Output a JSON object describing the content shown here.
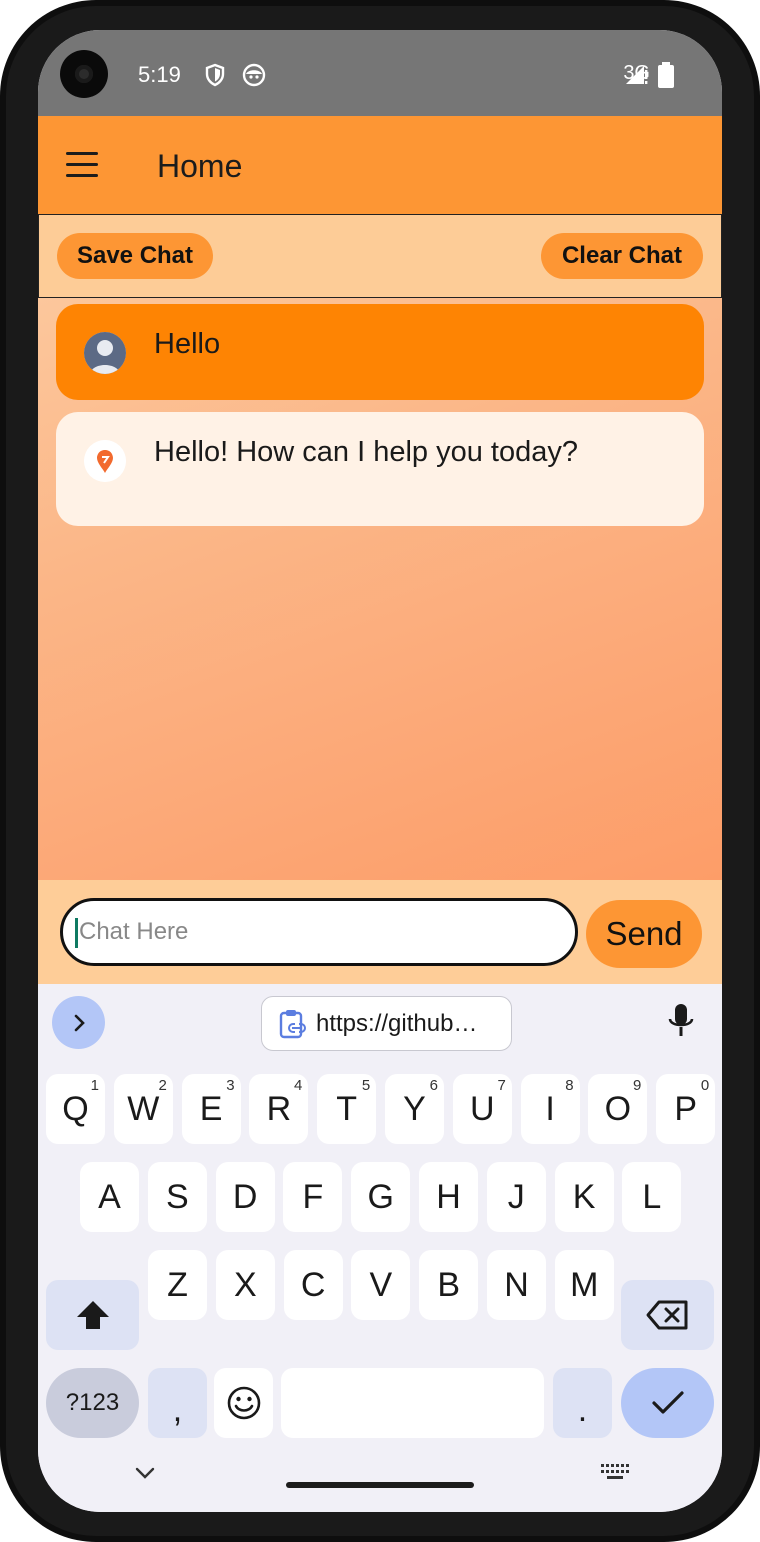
{
  "status": {
    "time": "5:19",
    "network": "3G"
  },
  "appbar": {
    "title": "Home"
  },
  "actions": {
    "save_label": "Save Chat",
    "clear_label": "Clear Chat"
  },
  "messages": [
    {
      "role": "user",
      "text": "Hello"
    },
    {
      "role": "bot",
      "text": "Hello! How can I help you today?"
    }
  ],
  "input": {
    "placeholder": "Chat Here",
    "value": "",
    "send_label": "Send"
  },
  "keyboard": {
    "clipboard_text": "https://github…",
    "row1": [
      {
        "k": "Q",
        "h": "1"
      },
      {
        "k": "W",
        "h": "2"
      },
      {
        "k": "E",
        "h": "3"
      },
      {
        "k": "R",
        "h": "4"
      },
      {
        "k": "T",
        "h": "5"
      },
      {
        "k": "Y",
        "h": "6"
      },
      {
        "k": "U",
        "h": "7"
      },
      {
        "k": "I",
        "h": "8"
      },
      {
        "k": "O",
        "h": "9"
      },
      {
        "k": "P",
        "h": "0"
      }
    ],
    "row2": [
      "A",
      "S",
      "D",
      "F",
      "G",
      "H",
      "J",
      "K",
      "L"
    ],
    "row3": [
      "Z",
      "X",
      "C",
      "V",
      "B",
      "N",
      "M"
    ],
    "sym_label": "?123",
    "comma": ",",
    "period": "."
  },
  "colors": {
    "accent": "#fd9634",
    "user_bubble": "#fe8403",
    "bot_bubble": "#fff2e6",
    "strip": "#fdcc97"
  }
}
